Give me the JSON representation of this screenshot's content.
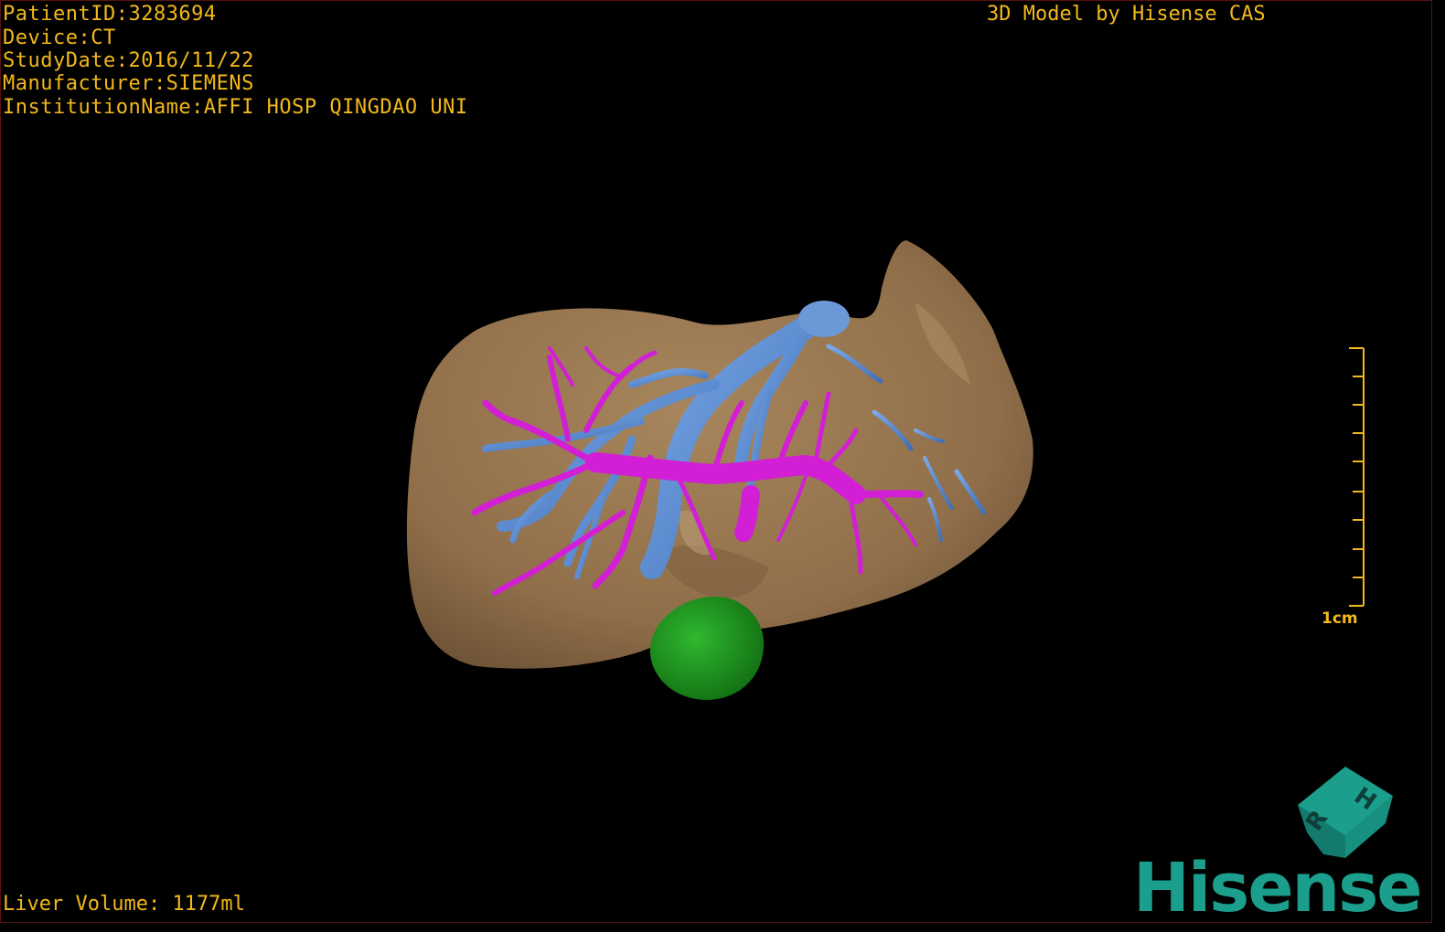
{
  "header": {
    "patient_id": "PatientID:3283694",
    "device": "Device:CT",
    "study_date": "StudyDate:2016/11/22",
    "manufacturer": "Manufacturer:SIEMENS",
    "institution": "InstitutionName:AFFI HOSP QINGDAO UNI",
    "model_title": "3D Model by Hisense CAS"
  },
  "footer": {
    "liver_volume": "Liver Volume: 1177ml"
  },
  "scale_bar": {
    "label": "1cm"
  },
  "orientation_cube": {
    "face_top": "H",
    "face_front": "R"
  },
  "logo": {
    "text": "Hisense"
  },
  "colors": {
    "overlay_text": "#f2b81c",
    "liver": "#9c7a52",
    "hepatic_vein": "#5b8fd6",
    "portal_vein": "#d21fd6",
    "tumor": "#1e9c1e",
    "brand": "#1b9f8c"
  }
}
